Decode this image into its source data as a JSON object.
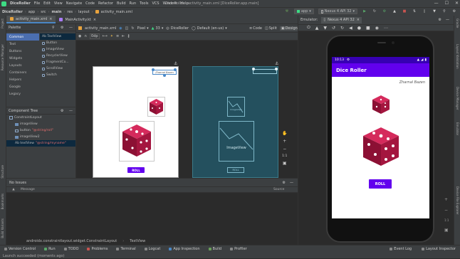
{
  "menubar": {
    "project": "DiceRoller",
    "items": [
      "File",
      "Edit",
      "View",
      "Navigate",
      "Code",
      "Refactor",
      "Build",
      "Run",
      "Tools",
      "VCS",
      "Window",
      "Help"
    ],
    "window_title": "Dice Roller - activity_main.xml [DiceRoller.app.main]"
  },
  "navbar": {
    "crumbs": [
      "DiceRoller",
      "app",
      "src",
      "main",
      "res",
      "layout",
      "activity_main.xml"
    ],
    "run_config": "app",
    "device": "Nexus 4 API 32"
  },
  "editor_tabs": [
    {
      "label": "activity_main.xml",
      "active": true
    },
    {
      "label": "MainActivity.kt",
      "active": false
    }
  ],
  "palette": {
    "title": "Palette",
    "categories": [
      "Common",
      "Text",
      "Buttons",
      "Widgets",
      "Layouts",
      "Containers",
      "Helpers",
      "Google",
      "Legacy"
    ],
    "items": [
      "Ab TextView",
      "Button",
      "ImageView",
      "RecyclerView",
      "FragmentCo...",
      "ScrollView",
      "Switch"
    ]
  },
  "component_tree": {
    "title": "Component Tree",
    "root": "ConstraintLayout",
    "nodes": [
      {
        "label": "imageView",
        "sub": ""
      },
      {
        "label": "button",
        "sub": "\"@string/roll\""
      },
      {
        "label": "imageView2",
        "sub": ""
      },
      {
        "label": "Ab textView",
        "sub": "\"@string/myname\""
      }
    ]
  },
  "designer": {
    "file": "activity_main.xml",
    "modes": [
      "Code",
      "Split",
      "Design"
    ],
    "device": "Pixel",
    "api": "33",
    "theme": "DiceRoller",
    "locale": "Default (en-us)",
    "dp": "0dp",
    "name_label": "Zharnal Bazen",
    "roll_label": "ROLL",
    "imageview_label": "ImageView",
    "zoom_ratio": "1:1"
  },
  "issues": {
    "title": "No Issues",
    "col_message": "Message",
    "col_source": "Source"
  },
  "pathbar": {
    "path": "androidx.constraintlayout.widget.ConstraintLayout",
    "leaf": "TextView"
  },
  "emulator": {
    "title": "Emulator:",
    "device_tab": "Nexus 4 API 32",
    "time": "10:13",
    "app_title": "Dice Roller",
    "name": "Zharnal Bazen",
    "roll": "ROLL"
  },
  "left_panels": [
    "Project",
    "Resource Manager",
    "Structure",
    "Bookmarks",
    "Build Variants"
  ],
  "right_panels": [
    "Gradle",
    "Layout Validation",
    "Device Manager",
    "Emulator",
    "Device File Explorer"
  ],
  "bottom_tools": [
    "Version Control",
    "Run",
    "TODO",
    "Problems",
    "Terminal",
    "Logcat",
    "App Inspection",
    "Build",
    "Profiler"
  ],
  "bottom_right_tools": [
    "Event Log",
    "Layout Inspector"
  ],
  "status": "Launch succeeded (moments ago)",
  "colors": {
    "purple": "#6200ee",
    "dark_purple": "#3700b3",
    "dice": "#a4163f"
  }
}
